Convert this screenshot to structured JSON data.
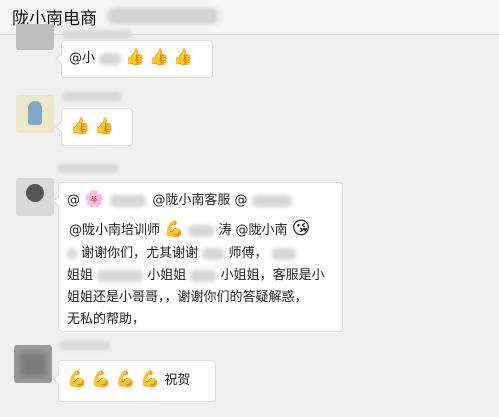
{
  "header": {
    "title": "陇小南电商"
  },
  "messages": [
    {
      "text": "@小",
      "emojis": [
        "👍",
        "👍",
        "👍"
      ]
    },
    {
      "emojis": [
        "👍",
        "👍"
      ]
    },
    {
      "line1": {
        "at": "@",
        "flower": "🌸",
        "mention1": "@陇小南客服",
        "mention2": "@"
      },
      "line2": {
        "mention1": "@陇小南培训师",
        "muscle": "💪",
        "part1": "涛",
        "mention2": "@陇小南",
        "kiss": "😘"
      },
      "line3": {
        "a": "谢谢你们，尤其谢谢",
        "b": "师傅，"
      },
      "line4": {
        "a": "姐姐",
        "b": "小姐姐",
        "c": "小姐姐，客服是小"
      },
      "line5": "姐姐还是小哥哥，，谢谢你们的答疑解惑，",
      "line6": "无私的帮助，"
    },
    {
      "emojis": [
        "💪",
        "💪",
        "💪",
        "💪"
      ],
      "text": "祝贺"
    }
  ],
  "icons": {
    "avatar1": "avatar-icon",
    "avatar2": "avatar-icon",
    "avatar3": "avatar-icon",
    "avatar4": "avatar-icon"
  }
}
